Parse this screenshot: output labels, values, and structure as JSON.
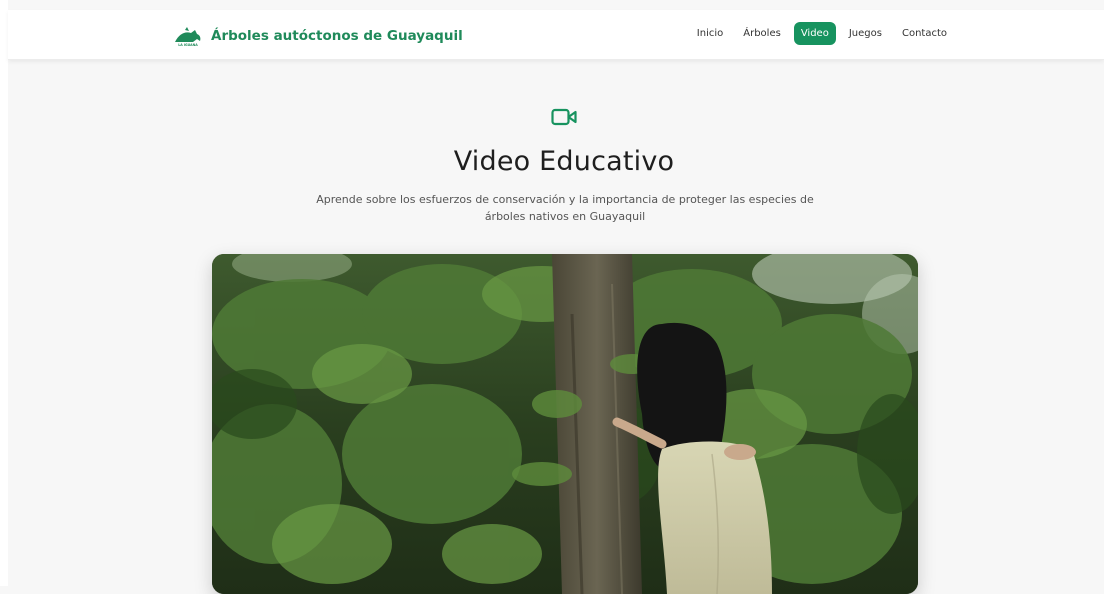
{
  "brand": {
    "logo_icon": "la-iguana-logo-icon",
    "logo_text": "LA IGUANA",
    "title": "Árboles autóctonos de Guayaquil"
  },
  "nav": {
    "items": [
      {
        "label": "Inicio",
        "active": false
      },
      {
        "label": "Árboles",
        "active": false
      },
      {
        "label": "Video",
        "active": true
      },
      {
        "label": "Juegos",
        "active": false
      },
      {
        "label": "Contacto",
        "active": false
      }
    ]
  },
  "hero": {
    "icon": "video-camera-icon",
    "title": "Video Educativo",
    "subtitle": "Aprende sobre los esfuerzos de conservación y la importancia de proteger las especies de árboles nativos en Guayaquil"
  },
  "video": {
    "description_icon": "video-player"
  },
  "colors": {
    "accent": "#17935f",
    "brand_text": "#1f8a5a",
    "background": "#f7f7f7"
  }
}
